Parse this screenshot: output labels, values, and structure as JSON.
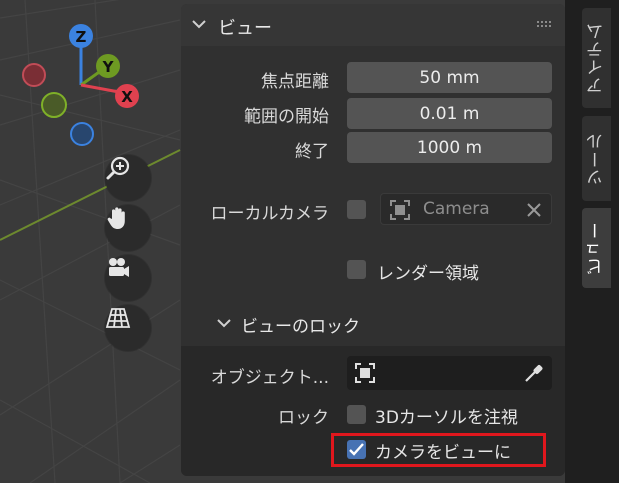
{
  "gizmo": {
    "z_label": "Z",
    "y_label": "Y",
    "x_label": "X"
  },
  "nav_buttons": {
    "zoom": "zoom-in-icon",
    "pan": "hand-icon",
    "camera": "camera-icon",
    "ortho": "grid-icon"
  },
  "view_panel": {
    "title": "ビュー",
    "focal_length_label": "焦点距離",
    "focal_length_value": "50 mm",
    "clip_start_label": "範囲の開始",
    "clip_start_value": "0.01 m",
    "clip_end_label": "終了",
    "clip_end_value": "1000 m",
    "local_camera_label": "ローカルカメラ",
    "local_camera_checked": false,
    "local_camera_value": "Camera",
    "render_region_label": "レンダー領域",
    "render_region_checked": false,
    "view_lock": {
      "title": "ビューのロック",
      "object_label": "オブジェクト...",
      "lock_label": "ロック",
      "cursor_lock_label": "3Dカーソルを注視",
      "cursor_lock_checked": false,
      "camera_to_view_label": "カメラをビューに",
      "camera_to_view_checked": true
    }
  },
  "sidebar_tabs": [
    {
      "label": "アイテム",
      "active": false
    },
    {
      "label": "ツール",
      "active": false
    },
    {
      "label": "ビュー",
      "active": true
    }
  ],
  "colors": {
    "axis_x": "#e0414f",
    "axis_y": "#6e9a22",
    "axis_z": "#3b82e0",
    "highlight": "#e0171d",
    "checkbox_on": "#4772b3"
  }
}
